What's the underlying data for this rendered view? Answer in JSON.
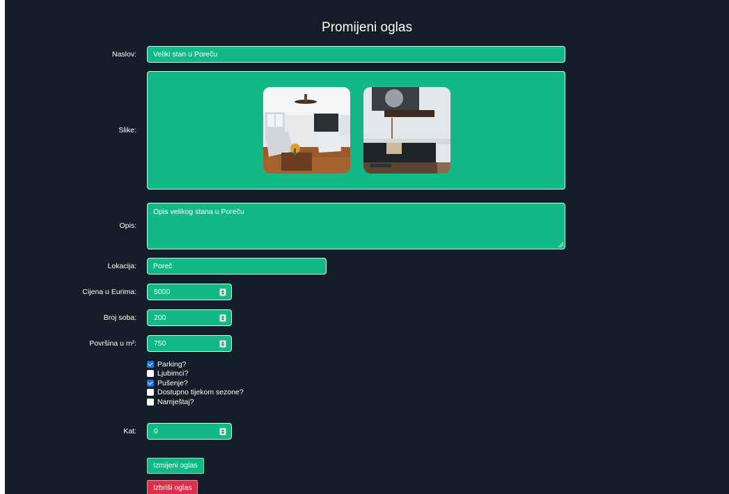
{
  "page": {
    "title": "Promijeni oglas"
  },
  "form": {
    "naslov": {
      "label": "Naslov:",
      "value": "Veliki stan u Poreču"
    },
    "slike": {
      "label": "Slike:",
      "images": [
        "living-room-photo",
        "lounge-sofa-photo"
      ]
    },
    "opis": {
      "label": "Opis:",
      "value": "Opis velikog stana u Poreču"
    },
    "lokacija": {
      "label": "Lokacija:",
      "value": "Poreč"
    },
    "cijena": {
      "label": "Cijena u Eurima:",
      "value": "5000"
    },
    "broj_soba": {
      "label": "Broj soba:",
      "value": "200"
    },
    "povrsina": {
      "label": "Površina u m²:",
      "value": "750"
    },
    "checkboxes": [
      {
        "label": "Parking?",
        "checked": true
      },
      {
        "label": "Ljubimci?",
        "checked": false
      },
      {
        "label": "Pušenje?",
        "checked": true
      },
      {
        "label": "Dostupno tijekom sezone?",
        "checked": false
      },
      {
        "label": "Namještaj?",
        "checked": false
      }
    ],
    "kat": {
      "label": "Kat:",
      "value": "0"
    }
  },
  "buttons": {
    "edit_label": "Izmijeni oglas",
    "delete_label": "Izbriši oglas"
  },
  "colors": {
    "background": "#131e28",
    "field": "#12b886",
    "delete": "#dc2f4a",
    "checkbox_checked": "#1a73e8"
  }
}
